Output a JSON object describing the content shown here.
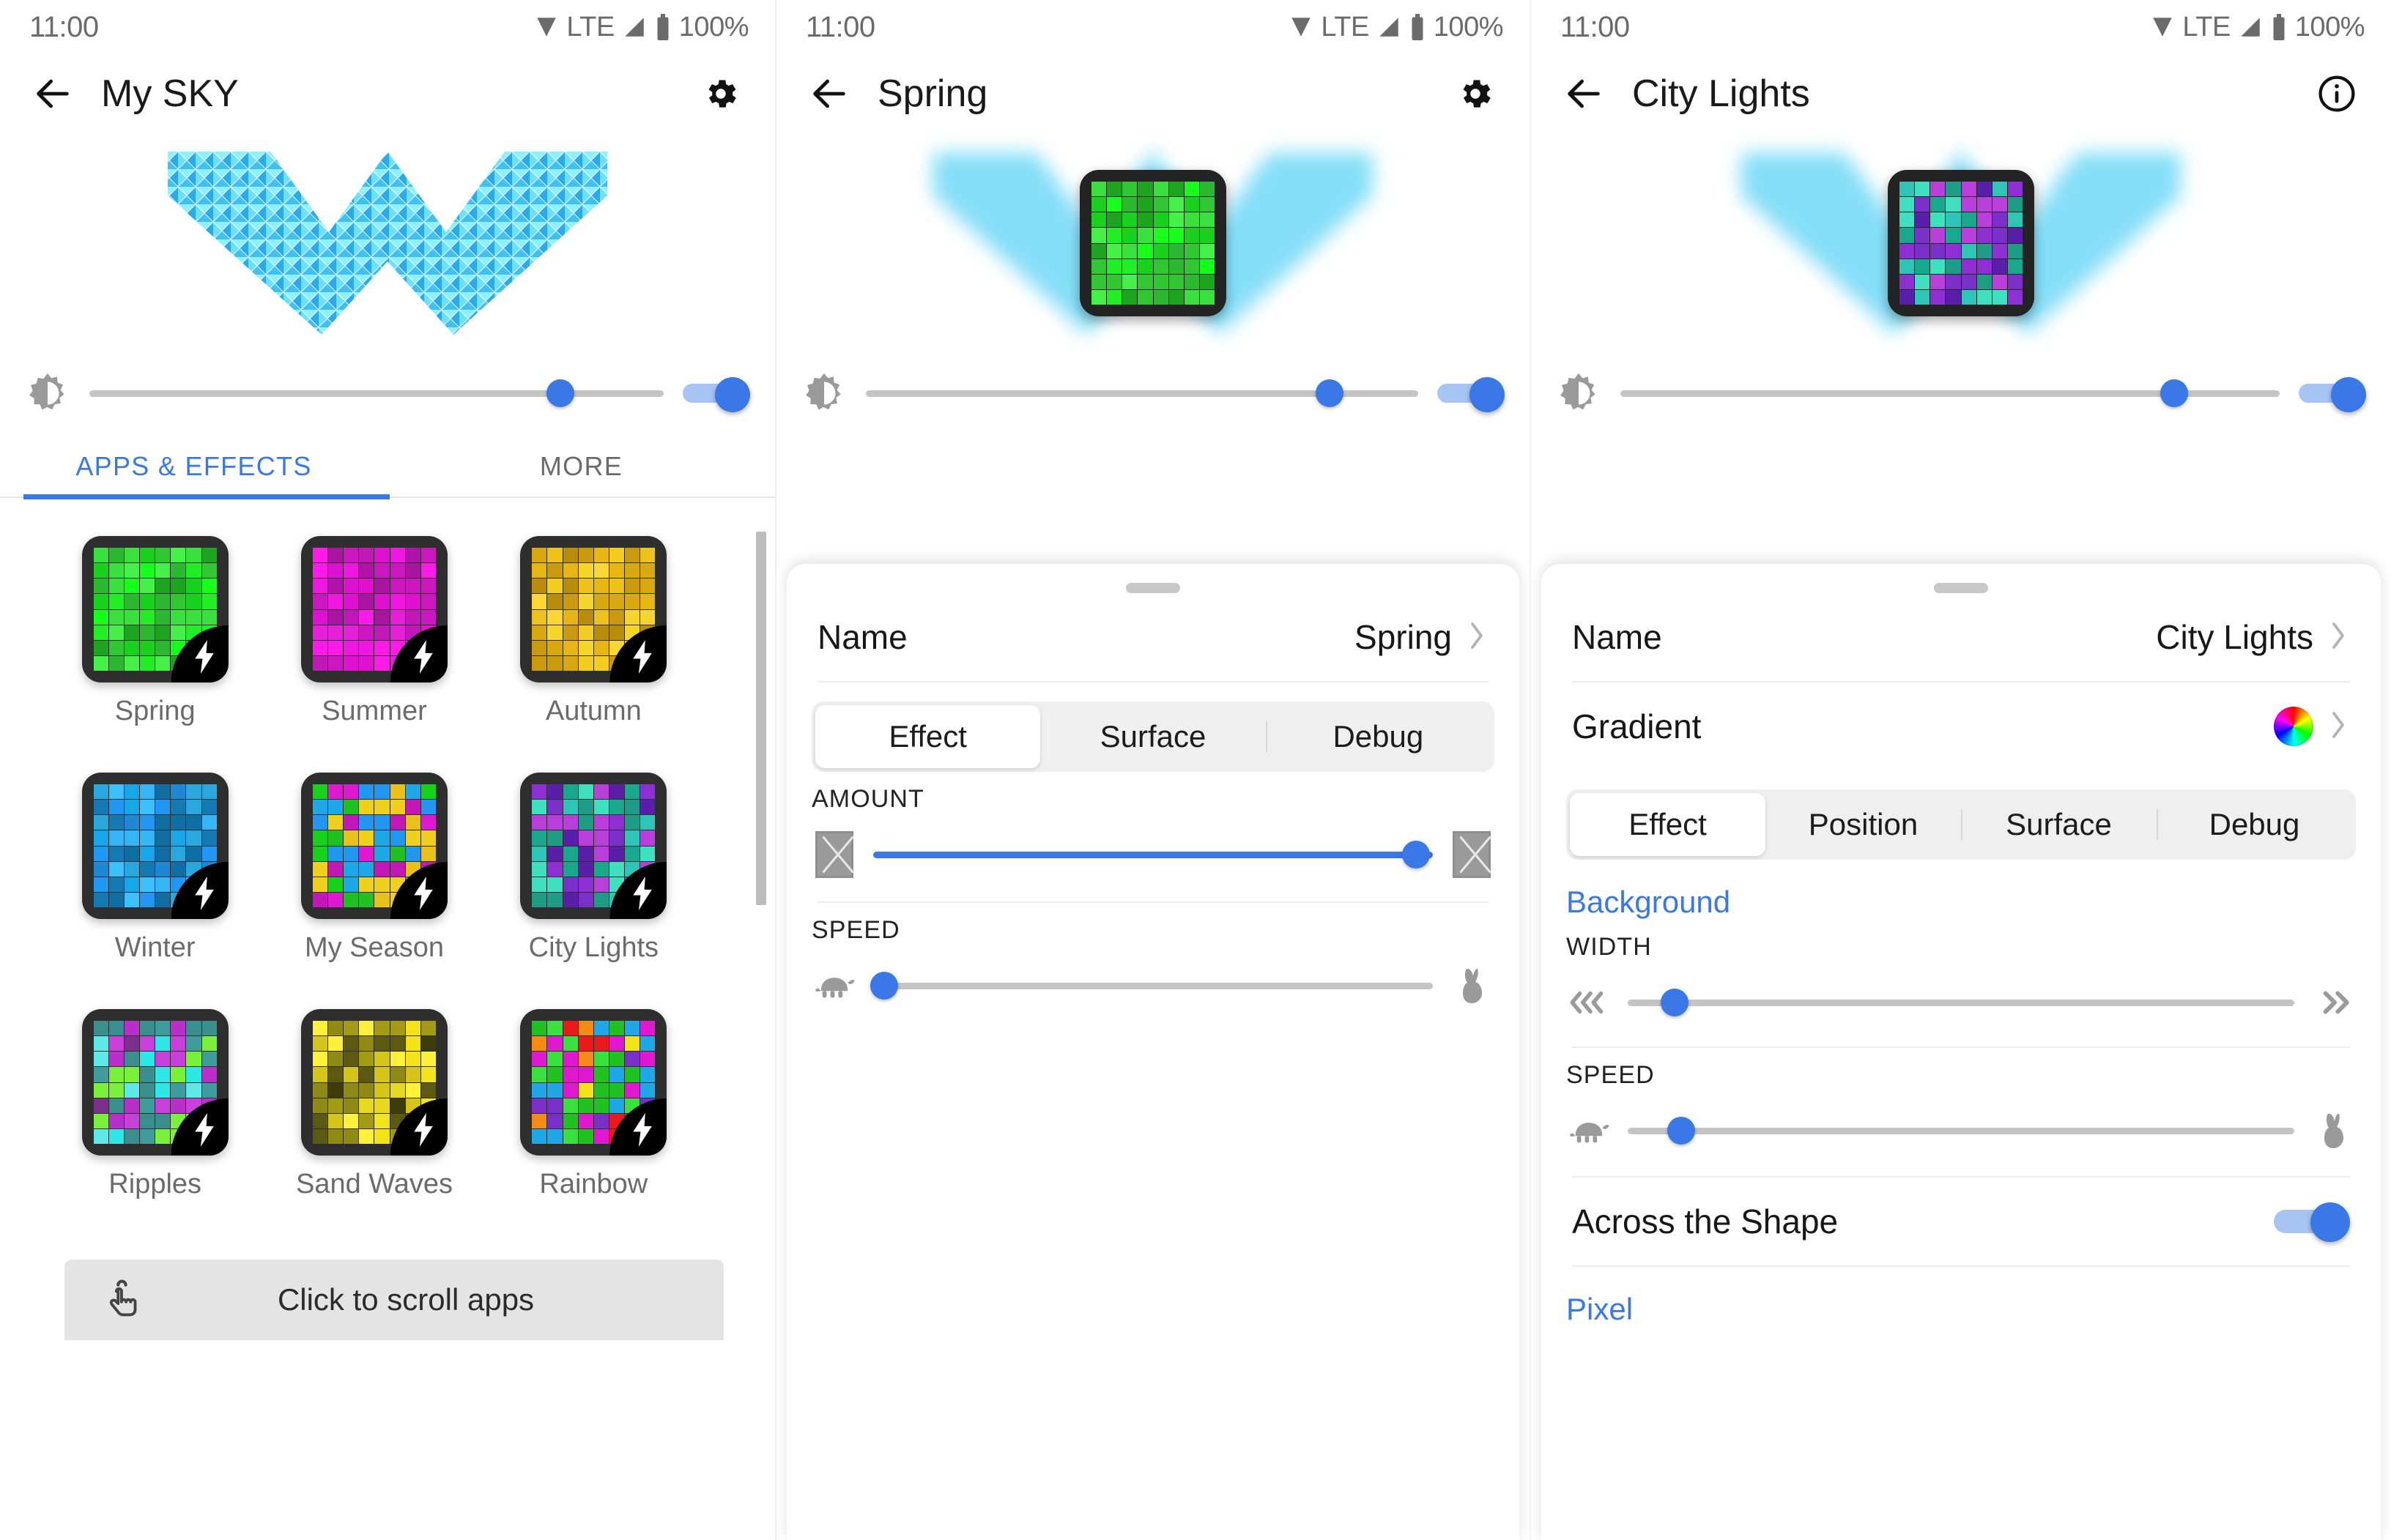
{
  "status_bar": {
    "time": "11:00",
    "network": "LTE",
    "battery": "100%"
  },
  "panel1": {
    "title": "My SKY",
    "back_icon": "arrow-left-icon",
    "action_icon": "gear-icon",
    "brightness": {
      "icon": "brightness-icon",
      "value": 82,
      "enabled": true
    },
    "tabs": [
      {
        "label": "APPS & EFFECTS",
        "active": true
      },
      {
        "label": "MORE",
        "active": false
      }
    ],
    "apps": [
      {
        "name": "Spring",
        "palette": [
          "#19d21d",
          "#2db832",
          "#22ee25",
          "#3ae03d",
          "#30c733",
          "#1da520",
          "#16ff1a",
          "#45f048"
        ]
      },
      {
        "name": "Summer",
        "palette": [
          "#f018e0",
          "#c218b8",
          "#e010d0",
          "#a914a0",
          "#ff1ae8",
          "#cc17c0",
          "#b312aa",
          "#e81fd8"
        ]
      },
      {
        "name": "Autumn",
        "palette": [
          "#e8b613",
          "#f5cc22",
          "#c99a0e",
          "#ffd633",
          "#d9a80f",
          "#eec21a",
          "#b88d0a",
          "#f7d62b"
        ]
      },
      {
        "name": "Winter",
        "palette": [
          "#17a7e8",
          "#2196f3",
          "#1e88d4",
          "#35b5f5",
          "#1579b3",
          "#29a8e0",
          "#0f6ea3",
          "#3cc0ff"
        ]
      },
      {
        "name": "My Season",
        "palette": [
          "#1fa8e8",
          "#22c122",
          "#e018d0",
          "#e8c01a",
          "#2196f3",
          "#16d21a",
          "#c218b8",
          "#f0d01f"
        ]
      },
      {
        "name": "City Lights",
        "palette": [
          "#7b2fc9",
          "#2ec4b6",
          "#b83fd9",
          "#19a88e",
          "#5a1fa8",
          "#3fe0c0",
          "#8e2fd4",
          "#1e9c86"
        ]
      },
      {
        "name": "Ripples",
        "palette": [
          "#3f9c9c",
          "#5ee8e8",
          "#7b2f8e",
          "#2ee8e8",
          "#7bf03a",
          "#b82fc9",
          "#3a8e8e",
          "#c93fd9"
        ]
      },
      {
        "name": "Sand Waves",
        "palette": [
          "#8e8a14",
          "#f5e31a",
          "#5c5a10",
          "#e8d820",
          "#3d3b0a",
          "#d4c518",
          "#a39c12",
          "#fff03a"
        ]
      },
      {
        "name": "Rainbow",
        "palette": [
          "#e81a1a",
          "#f58a14",
          "#f5e31a",
          "#3ae03d",
          "#1fa8e8",
          "#7b2fc9",
          "#e018d0",
          "#22c122"
        ]
      }
    ],
    "scroll_hint": {
      "icon": "tap-hand-icon",
      "text": "Click to scroll apps"
    }
  },
  "panel2": {
    "title": "Spring",
    "back_icon": "arrow-left-icon",
    "action_icon": "gear-icon",
    "brightness": {
      "icon": "brightness-icon",
      "value": 84,
      "enabled": true
    },
    "name_row": {
      "label": "Name",
      "value": "Spring",
      "chevron": "chevron-right-icon"
    },
    "tabs": [
      {
        "label": "Effect",
        "active": true
      },
      {
        "label": "Surface",
        "active": false
      },
      {
        "label": "Debug",
        "active": false
      }
    ],
    "controls": [
      {
        "label": "AMOUNT",
        "value": 97,
        "left_icon": "missing-image-icon",
        "right_icon": "missing-image-icon",
        "filled": true
      },
      {
        "label": "SPEED",
        "value": 2,
        "left_icon": "turtle-icon",
        "right_icon": "rabbit-icon",
        "filled": false
      }
    ]
  },
  "panel3": {
    "title": "City Lights",
    "back_icon": "arrow-left-icon",
    "action_icon": "info-icon",
    "brightness": {
      "icon": "brightness-icon",
      "value": 84,
      "enabled": true
    },
    "name_row": {
      "label": "Name",
      "value": "City Lights",
      "chevron": "chevron-right-icon"
    },
    "gradient_row": {
      "label": "Gradient",
      "swatch": "rainbow-gradient-swatch",
      "chevron": "chevron-right-icon"
    },
    "tabs": [
      {
        "label": "Effect",
        "active": true
      },
      {
        "label": "Position",
        "active": false
      },
      {
        "label": "Surface",
        "active": false
      },
      {
        "label": "Debug",
        "active": false
      }
    ],
    "section_background": "Background",
    "controls": [
      {
        "label": "WIDTH",
        "value": 7,
        "left_icon": "chevrons-left-icon",
        "right_icon": "chevrons-right-icon"
      },
      {
        "label": "SPEED",
        "value": 8,
        "left_icon": "turtle-icon",
        "right_icon": "rabbit-icon"
      }
    ],
    "across_shape": {
      "label": "Across the Shape",
      "enabled": true
    },
    "section_pixel": "Pixel"
  },
  "colors": {
    "accent": "#3b78e7",
    "track_inactive": "#c4c4c4",
    "muted_text": "#6b6b6b",
    "sheet_bg": "#ffffff"
  }
}
